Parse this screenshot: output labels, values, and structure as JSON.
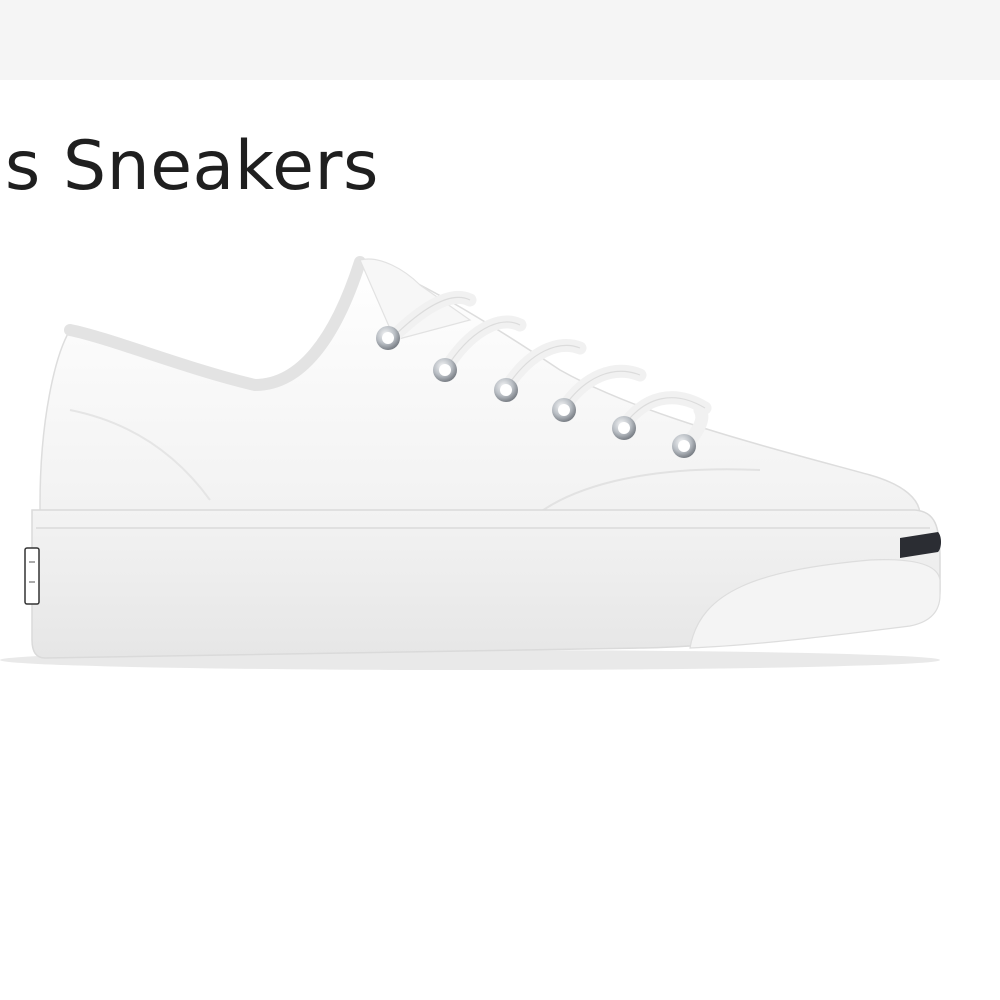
{
  "header": {
    "bar_color": "#f5f5f5"
  },
  "product": {
    "title": "vas Sneakers",
    "image": {
      "subject": "sneaker-illustration",
      "upper_color": "#ffffff",
      "sole_color": "#efefef",
      "toe_stripe_color": "#2b2d33",
      "eyelet_color": "#9a9fa6"
    }
  }
}
